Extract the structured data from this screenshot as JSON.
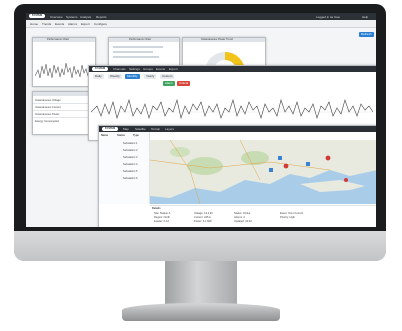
{
  "app": {
    "brand": "SYSTEM",
    "top_menu": [
      "Overview",
      "Systems",
      "Analysis",
      "Reports"
    ],
    "user_label": "Logged in as User",
    "help_label": "Help"
  },
  "toolbar": {
    "items": [
      "Home",
      "Trends",
      "Events",
      "Alarms",
      "Export",
      "Configure"
    ],
    "action_button": "Refresh"
  },
  "panels": {
    "left_title": "Performance Chart",
    "mid_title": "Performance Chart",
    "gauge_title": "Instantaneous Power Trend"
  },
  "trend_window": {
    "tabs": [
      "Channels",
      "Settings",
      "Groups",
      "Events",
      "Export"
    ],
    "filters": [
      "Daily",
      "Weekly",
      "Monthly",
      "Yearly",
      "Custom"
    ],
    "active_filter": "Monthly",
    "highlight_filters": [
      "Alarm",
      "Critical"
    ]
  },
  "left_table": {
    "rows": [
      "Instantaneous Voltage",
      "Instantaneous Current",
      "Instantaneous Power",
      "Energy Consumption"
    ]
  },
  "map_window": {
    "tabs": [
      "Map",
      "Satellite",
      "Terrain",
      "Layers"
    ],
    "list_header": [
      "Name",
      "Status",
      "Type"
    ],
    "list_rows": [
      "Substation 1",
      "Substation 2",
      "Substation 3",
      "Substation 4",
      "Substation 5",
      "Substation 6"
    ],
    "details_title": "Details",
    "details_col1": [
      "Site: Station A",
      "Region: North",
      "Feeder: F-12"
    ],
    "details_col2": [
      "Voltage: 13.2 kV",
      "Current: 245 A",
      "Power: 3.1 MW"
    ],
    "details_col3": [
      "Status: Online",
      "Alarms: 2",
      "Updated: 10:42"
    ],
    "details_col4": [
      "Event: Over Current",
      "Priority: High"
    ]
  },
  "colors": {
    "header": "#2c3138",
    "accent": "#2a7fd4",
    "gauge": "#f2c318",
    "alarm_green": "#3da35d",
    "alarm_red": "#d9453a",
    "marker_blue": "#3b82d6",
    "marker_red": "#d23a33"
  }
}
